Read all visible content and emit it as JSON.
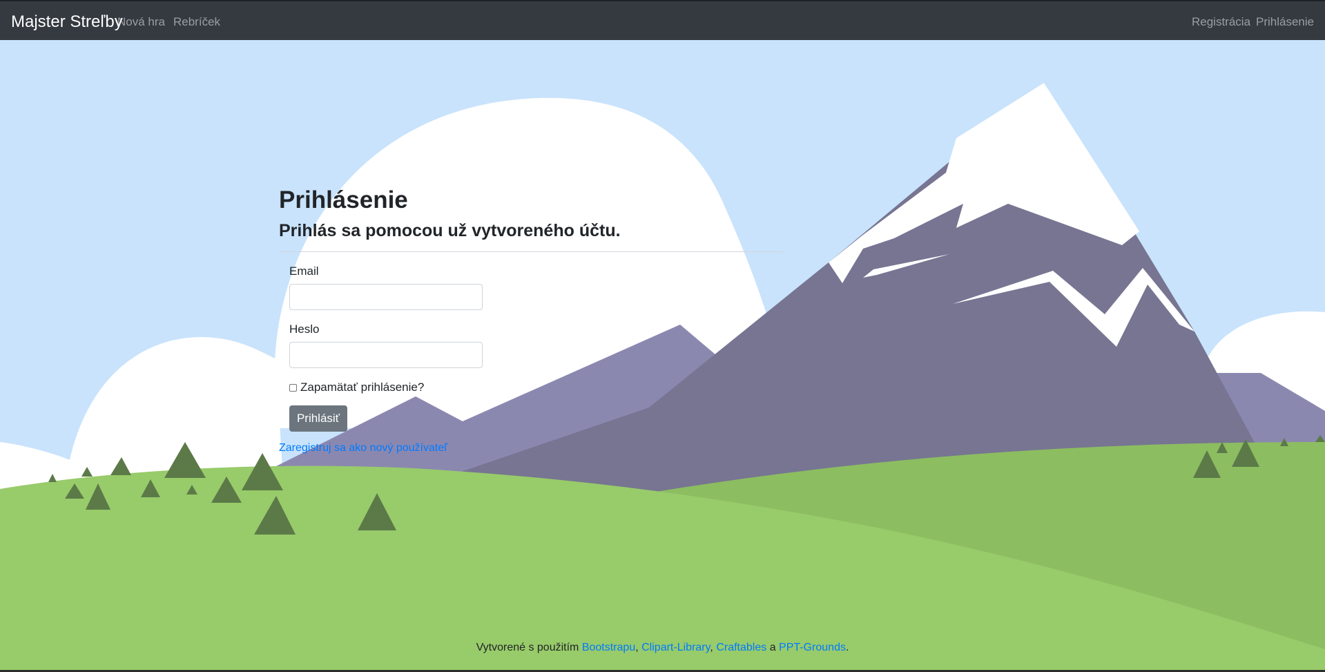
{
  "navbar": {
    "brand": "Majster Streľby",
    "left_links": [
      "Nová hra",
      "Rebríček"
    ],
    "right_links": [
      "Registrácia",
      "Prihlásenie"
    ]
  },
  "login": {
    "title": "Prihlásenie",
    "subtitle": "Prihlás sa pomocou už vytvoreného účtu.",
    "email_label": "Email",
    "email_value": "",
    "password_label": "Heslo",
    "password_value": "",
    "remember_label": "Zapamätať prihlásenie?",
    "remember_checked": false,
    "submit_label": "Prihlásiť",
    "register_link": "Zaregistruj sa ako nový používateľ"
  },
  "footer": {
    "prefix": "Vytvorené s použitím",
    "links": [
      "Bootstrapu",
      "Clipart-Library",
      "Craftables",
      "PPT-Grounds"
    ],
    "separator": ",",
    "conjunction": "a",
    "suffix": "."
  },
  "colors": {
    "navbar_bg": "#343a40",
    "sky": "#c9e3fc",
    "mountain": "#777592",
    "mountain_far": "#8b88b0",
    "grass": "#98cb6a",
    "tree": "#5c7a48",
    "link": "#007bff",
    "button": "#6c757d"
  }
}
